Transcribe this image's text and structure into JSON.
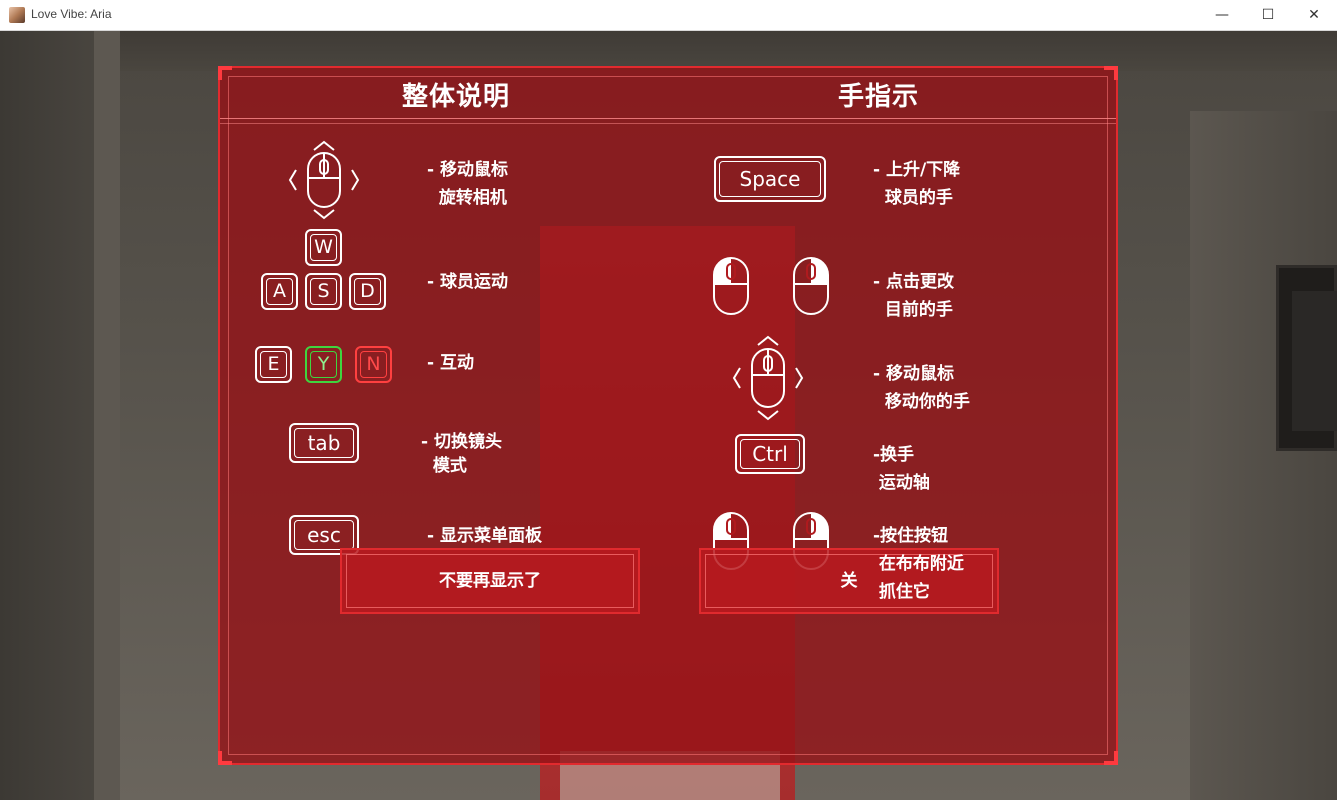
{
  "window": {
    "title": "Love Vibe: Aria",
    "minimize_glyph": "—",
    "maximize_glyph": "☐",
    "close_glyph": "✕"
  },
  "panel": {
    "left_heading": "整体说明",
    "right_heading": "手指示",
    "left_items": [
      {
        "icon": "mouse-move-icon",
        "text": "- 移动鼠标\n  旋转相机"
      },
      {
        "icon": "wasd-keys-icon",
        "keys": [
          "W",
          "A",
          "S",
          "D"
        ],
        "text": "- 球员运动"
      },
      {
        "icon": "eyn-keys-icon",
        "keys": [
          "E",
          "Y",
          "N"
        ],
        "text": "- 互动"
      },
      {
        "icon": "tab-key-icon",
        "key": "tab",
        "text": "- 切换镜头\n  模式"
      },
      {
        "icon": "esc-key-icon",
        "key": "esc",
        "text": "- 显示菜单面板"
      }
    ],
    "right_items": [
      {
        "icon": "space-key-icon",
        "key": "Space",
        "text": "- 上升/下降\n  球员的手"
      },
      {
        "icon": "mouse-click-icon",
        "text": "- 点击更改\n  目前的手"
      },
      {
        "icon": "mouse-move-icon",
        "text": "- 移动鼠标\n  移动你的手"
      },
      {
        "icon": "ctrl-key-icon",
        "key": "Ctrl",
        "text": "-换手\n 运动轴"
      },
      {
        "icon": "mouse-hold-icon",
        "text": "-按住按钮\n 在布布附近\n 抓住它"
      }
    ],
    "buttons": {
      "dont_show": "不要再显示了",
      "close": "关"
    },
    "colors": {
      "panel": "#961216",
      "border": "#e22a2e",
      "key_green": "#3fd53f",
      "key_red": "#ff4040"
    }
  }
}
